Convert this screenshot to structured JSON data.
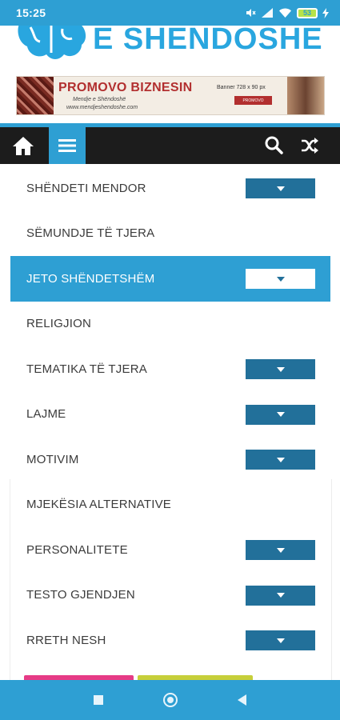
{
  "status_bar": {
    "time": "15:25",
    "battery": "53",
    "icons": [
      "mute-icon",
      "signal-icon",
      "wifi-icon",
      "battery-icon",
      "charging-icon"
    ]
  },
  "header": {
    "logo_text": "E SHENDOSHE",
    "logo_icon": "brain-icon"
  },
  "banner": {
    "title": "PROMOVO BIZNESIN",
    "subtitle": "Mendje e Shëndoshë",
    "site": "www.mendjeshendoshe.com",
    "size_text": "Banner 728 x 90 px",
    "button_label": "PROMOVO"
  },
  "navbar": {
    "icons": [
      "home-icon",
      "menu-icon",
      "search-icon",
      "shuffle-icon"
    ]
  },
  "menu": {
    "items": [
      {
        "label": "SHËNDETI MENDOR",
        "has_dropdown": true,
        "active": false
      },
      {
        "label": "SËMUNDJE TË TJERA",
        "has_dropdown": false,
        "active": false
      },
      {
        "label": "JETO SHËNDETSHËM",
        "has_dropdown": true,
        "active": true
      },
      {
        "label": "RELIGJION",
        "has_dropdown": false,
        "active": false
      },
      {
        "label": "TEMATIKA TË TJERA",
        "has_dropdown": true,
        "active": false
      },
      {
        "label": "LAJME",
        "has_dropdown": true,
        "active": false
      },
      {
        "label": "MOTIVIM",
        "has_dropdown": true,
        "active": false
      },
      {
        "label": "MJEKËSIA ALTERNATIVE",
        "has_dropdown": false,
        "active": false
      },
      {
        "label": "PERSONALITETE",
        "has_dropdown": true,
        "active": false
      },
      {
        "label": "TESTO GJENDJEN",
        "has_dropdown": true,
        "active": false
      },
      {
        "label": "RRETH NESH",
        "has_dropdown": true,
        "active": false
      }
    ]
  },
  "colors": {
    "accent": "#2e9fd3",
    "dark_nav": "#1c1c1c",
    "toggle": "#22709a",
    "text": "#3b3b3b",
    "pink": "#e63b86",
    "lime": "#c6cf3a"
  },
  "bottom_nav": {
    "icons": [
      "recent-apps-icon",
      "home-circle-icon",
      "back-icon"
    ]
  }
}
